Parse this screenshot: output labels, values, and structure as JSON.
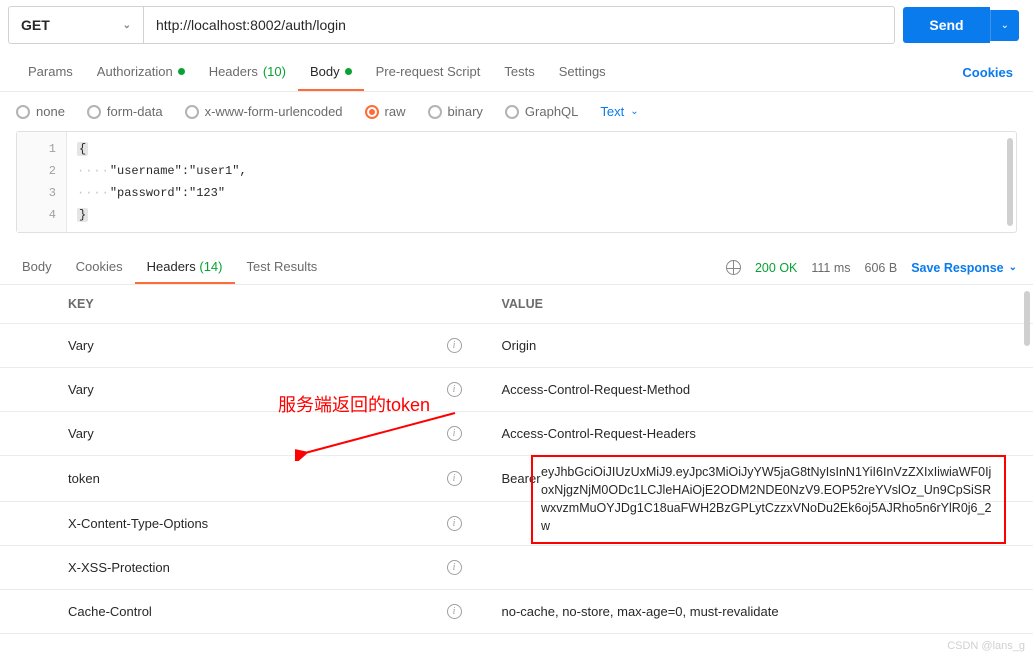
{
  "request": {
    "method": "GET",
    "url": "http://localhost:8002/auth/login",
    "send_label": "Send"
  },
  "req_tabs": {
    "params": "Params",
    "authorization": "Authorization",
    "headers": "Headers",
    "headers_count": "(10)",
    "body": "Body",
    "prerequest": "Pre-request Script",
    "tests": "Tests",
    "settings": "Settings",
    "cookies": "Cookies"
  },
  "body_types": {
    "none": "none",
    "formdata": "form-data",
    "urlencoded": "x-www-form-urlencoded",
    "raw": "raw",
    "binary": "binary",
    "graphql": "GraphQL",
    "text_dropdown": "Text"
  },
  "editor": {
    "lines": [
      "1",
      "2",
      "3",
      "4"
    ],
    "l1": "{",
    "l2_key": "\"username\"",
    "l2_val": "\"user1\"",
    "l3_key": "\"password\"",
    "l3_val": "\"123\"",
    "l4": "}"
  },
  "resp_tabs": {
    "body": "Body",
    "cookies": "Cookies",
    "headers": "Headers",
    "headers_count": "(14)",
    "testresults": "Test Results",
    "status": "200 OK",
    "time": "111 ms",
    "size": "606 B",
    "save": "Save Response"
  },
  "headers_table": {
    "key_label": "KEY",
    "value_label": "VALUE",
    "rows": [
      {
        "k": "Vary",
        "v": "Origin"
      },
      {
        "k": "Vary",
        "v": "Access-Control-Request-Method"
      },
      {
        "k": "Vary",
        "v": "Access-Control-Request-Headers"
      },
      {
        "k": "token",
        "v": "Bearer"
      },
      {
        "k": "X-Content-Type-Options",
        "v": ""
      },
      {
        "k": "X-XSS-Protection",
        "v": ""
      },
      {
        "k": "Cache-Control",
        "v": "no-cache, no-store, max-age=0, must-revalidate"
      }
    ]
  },
  "annotation": {
    "label": "服务端返回的token",
    "token_value": "eyJhbGciOiJIUzUxMiJ9.eyJpc3MiOiJyYW5jaG8tNyIsInN1YiI6InVzZXIxIiwiaWF0IjoxNjgzNjM0ODc1LCJleHAiOjE2ODM2NDE0NzV9.EOP52reYVslOz_Un9CpSiSRwxvzmMuOYJDg1C18uaFWH2BzGPLytCzzxVNoDu2Ek6oj5AJRho5n6rYlR0j6_2w"
  },
  "watermark": "CSDN @lans_g"
}
